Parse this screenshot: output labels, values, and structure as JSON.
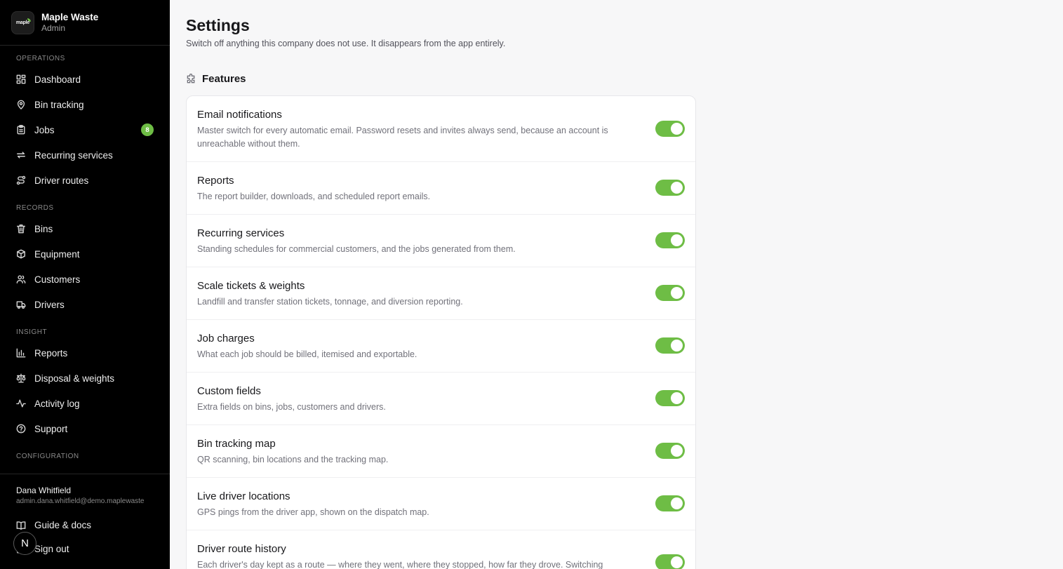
{
  "brand": {
    "logo_text": "maple",
    "name": "Maple Waste",
    "role": "Admin"
  },
  "sidebar": {
    "sections": {
      "operations": "OPERATIONS",
      "records": "RECORDS",
      "insight": "INSIGHT",
      "configuration": "CONFIGURATION"
    },
    "items": {
      "dashboard": "Dashboard",
      "bin_tracking": "Bin tracking",
      "jobs": "Jobs",
      "jobs_badge": "8",
      "recurring": "Recurring services",
      "driver_routes": "Driver routes",
      "bins": "Bins",
      "equipment": "Equipment",
      "customers": "Customers",
      "drivers": "Drivers",
      "reports": "Reports",
      "disposal": "Disposal & weights",
      "activity": "Activity log",
      "support": "Support"
    },
    "user": {
      "name": "Dana Whitfield",
      "email": "admin.dana.whitfield@demo.maplewaste"
    },
    "guide": "Guide & docs",
    "signout": "Sign out",
    "avatar_letter": "N"
  },
  "page": {
    "title": "Settings",
    "subtitle": "Switch off anything this company does not use. It disappears from the app entirely.",
    "section_title": "Features"
  },
  "features": [
    {
      "title": "Email notifications",
      "desc": "Master switch for every automatic email. Password resets and invites always send, because an account is unreachable without them.",
      "enabled": true
    },
    {
      "title": "Reports",
      "desc": "The report builder, downloads, and scheduled report emails.",
      "enabled": true
    },
    {
      "title": "Recurring services",
      "desc": "Standing schedules for commercial customers, and the jobs generated from them.",
      "enabled": true
    },
    {
      "title": "Scale tickets & weights",
      "desc": "Landfill and transfer station tickets, tonnage, and diversion reporting.",
      "enabled": true
    },
    {
      "title": "Job charges",
      "desc": "What each job should be billed, itemised and exportable.",
      "enabled": true
    },
    {
      "title": "Custom fields",
      "desc": "Extra fields on bins, jobs, customers and drivers.",
      "enabled": true
    },
    {
      "title": "Bin tracking map",
      "desc": "QR scanning, bin locations and the tracking map.",
      "enabled": true
    },
    {
      "title": "Live driver locations",
      "desc": "GPS pings from the driver app, shown on the dispatch map.",
      "enabled": true
    },
    {
      "title": "Driver route history",
      "desc": "Each driver's day kept as a route — where they went, where they stopped, how far they drove. Switching",
      "enabled": true
    }
  ],
  "colors": {
    "accent": "#6ebd45",
    "sidebar_bg": "#000000"
  }
}
